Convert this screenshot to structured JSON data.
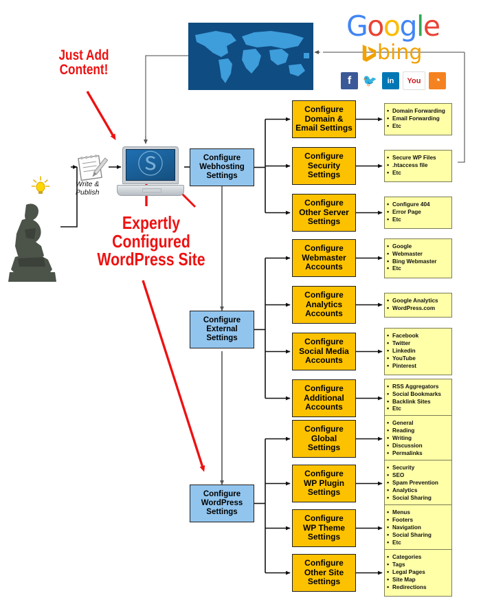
{
  "title": "Expertly Configured WordPress Site",
  "annotations": {
    "just_add_content": "Just Add\nContent!",
    "expertly_configured": "Expertly\nConfigured\nWordPress Site",
    "write_publish": "Write &\nPublish"
  },
  "colors": {
    "blue_box": "#92c5ee",
    "orange_box": "#fcc200",
    "yellow_box": "#ffffa8",
    "red_annotation": "#ee1111",
    "map_background": "#0f4c81",
    "map_land": "#3e9ddb"
  },
  "icons": {
    "thinker_statue": "thinker-statue",
    "idea_bulb": "lightbulb-icon",
    "notepad": "notepad-pencil-icon",
    "laptop": "laptop-icon",
    "wordpress_logo": "wordpress-logo",
    "world_map": "world-map-image"
  },
  "logos": {
    "google": {
      "name": "google-logo",
      "letters": [
        {
          "ch": "G",
          "color": "#4285F4"
        },
        {
          "ch": "o",
          "color": "#EA4335"
        },
        {
          "ch": "o",
          "color": "#FBBC05"
        },
        {
          "ch": "g",
          "color": "#4285F4"
        },
        {
          "ch": "l",
          "color": "#34A853"
        },
        {
          "ch": "e",
          "color": "#EA4335"
        }
      ]
    },
    "bing": {
      "name": "bing-logo",
      "label": "bing",
      "color": "#f2a100"
    },
    "social": [
      {
        "name": "facebook-icon",
        "label": "f",
        "bg": "#3b5998"
      },
      {
        "name": "twitter-icon",
        "label": "🐦",
        "bg": "#ffffff",
        "fg": "#55acee"
      },
      {
        "name": "linkedin-icon",
        "label": "in",
        "bg": "#0077b5"
      },
      {
        "name": "youtube-icon",
        "label": "You",
        "bg": "#ffffff",
        "fg": "#cc181e"
      },
      {
        "name": "rss-icon",
        "label": "◔",
        "bg": "#f58220"
      }
    ]
  },
  "branches": [
    {
      "id": "webhosting",
      "hub": "Configure\nWebhosting\nSettings",
      "steps": [
        {
          "label": "Configure\nDomain &\nEmail Settings",
          "details": [
            "Domain Forwarding",
            "Email Forwarding",
            "Etc"
          ]
        },
        {
          "label": "Configure\nSecurity\nSettings",
          "details": [
            "Secure WP Files",
            ".htaccess file",
            "Etc"
          ]
        },
        {
          "label": "Configure\nOther Server\nSettings",
          "details": [
            "Configure 404",
            "Error Page",
            "Etc"
          ]
        }
      ]
    },
    {
      "id": "external",
      "hub": "Configure\nExternal\nSettings",
      "steps": [
        {
          "label": "Configure\nWebmaster\nAccounts",
          "details": [
            "Google",
            "Webmaster",
            "Bing Webmaster",
            "Etc"
          ]
        },
        {
          "label": "Configure\nAnalytics\nAccounts",
          "details": [
            "Google Analytics",
            "WordPress.com"
          ]
        },
        {
          "label": "Configure\nSocial Media\nAccounts",
          "details": [
            "Facebook",
            "Twitter",
            "Linkedin",
            "YouTube",
            "Pinterest"
          ]
        },
        {
          "label": "Configure\nAdditional\nAccounts",
          "details": [
            "RSS Aggregators",
            "Social Bookmarks",
            "Backlink Sites",
            "Etc"
          ]
        }
      ]
    },
    {
      "id": "wordpress",
      "hub": "Configure\nWordPress\nSettings",
      "steps": [
        {
          "label": "Configure\nGlobal\nSettings",
          "details": [
            "General",
            "Reading",
            "Writing",
            "Discussion",
            "Permalinks"
          ]
        },
        {
          "label": "Configure\nWP Plugin\nSettings",
          "details": [
            "Security",
            "SEO",
            "Spam Prevention",
            "Analytics",
            "Social Sharing"
          ]
        },
        {
          "label": "Configure\nWP Theme\nSettings",
          "details": [
            "Menus",
            "Footers",
            "Navigation",
            "Social Sharing",
            "Etc"
          ]
        },
        {
          "label": "Configure\nOther Site\nSettings",
          "details": [
            "Categories",
            "Tags",
            "Legal Pages",
            "Site Map",
            "Redirections"
          ]
        }
      ]
    }
  ]
}
